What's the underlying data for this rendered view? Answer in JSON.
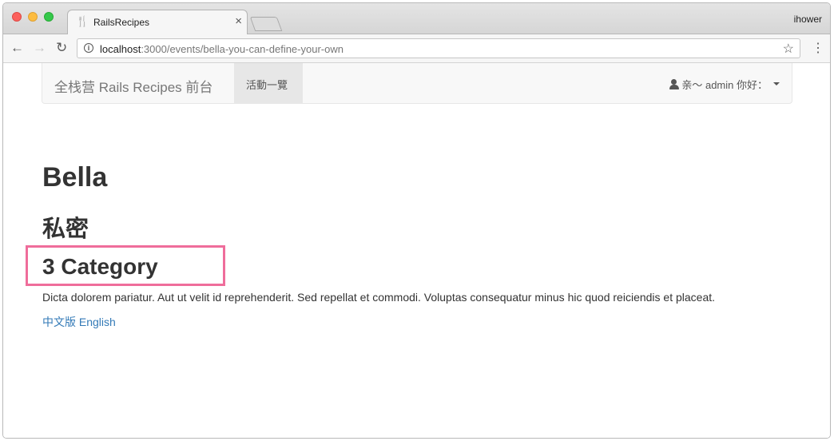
{
  "browser": {
    "tab_title": "RailsRecipes",
    "tab_close": "×",
    "username": "ihower",
    "url_host": "localhost",
    "url_path": ":3000/events/bella-you-can-define-your-own",
    "icons": {
      "tab": "fork-knife-icon",
      "back": "back-arrow-icon",
      "forward": "forward-arrow-icon",
      "reload": "reload-icon",
      "info": "info-icon",
      "bookmark": "star-icon",
      "menu": "kebab-menu-icon"
    }
  },
  "navbar": {
    "brand": "全栈营 Rails Recipes 前台",
    "nav_link": "活動一覽",
    "user_menu": "亲～ admin 你好："
  },
  "event": {
    "name": "Bella",
    "status": "私密",
    "category": "3 Category",
    "description": "Dicta dolorem pariatur. Aut ut velit id reprehenderit. Sed repellat et commodi. Voluptas consequatur minus hic quod reiciendis et placeat.",
    "lang_zh": "中文版",
    "lang_en": "English"
  },
  "colors": {
    "highlight": "#ef6d9b",
    "link": "#337ab7"
  }
}
